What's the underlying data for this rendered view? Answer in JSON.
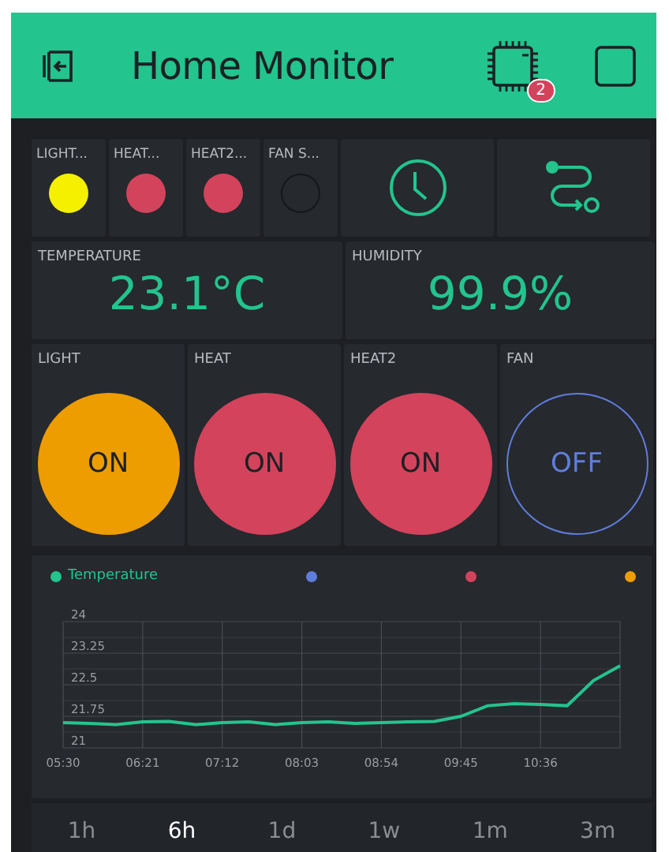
{
  "header": {
    "title": "Home Monitor",
    "badge": "2"
  },
  "leds": [
    {
      "label": "LIGHT...",
      "on": true,
      "color": "#f5f000"
    },
    {
      "label": "HEAT...",
      "on": true,
      "color": "#d3435c"
    },
    {
      "label": "HEAT2...",
      "on": true,
      "color": "#d3435c"
    },
    {
      "label": "FAN S...",
      "on": false
    }
  ],
  "displays": [
    {
      "label": "TEMPERATURE",
      "value": "23.1°C"
    },
    {
      "label": "HUMIDITY",
      "value": "99.9%"
    }
  ],
  "buttons": [
    {
      "label": "LIGHT",
      "state": "ON",
      "on": true,
      "color": "#ed9d00"
    },
    {
      "label": "HEAT",
      "state": "ON",
      "on": true,
      "color": "#d3435c"
    },
    {
      "label": "HEAT2",
      "state": "ON",
      "on": true,
      "color": "#d3435c"
    },
    {
      "label": "FAN",
      "state": "OFF",
      "on": false,
      "color": "#5f7ddb"
    }
  ],
  "legend": [
    {
      "color": "#5f7ddb"
    },
    {
      "color": "#d3435c"
    },
    {
      "color": "#ed9d00"
    }
  ],
  "chart_data": {
    "type": "line",
    "categories": [
      "05:30",
      null,
      null,
      "06:21",
      null,
      null,
      "07:12",
      null,
      null,
      "08:03",
      null,
      null,
      "08:54",
      null,
      null,
      "09:45",
      null,
      null,
      "10:36",
      null,
      null,
      null
    ],
    "series": [
      {
        "name": "Temperature",
        "color": "#23c48e",
        "values": [
          21.6,
          21.58,
          21.55,
          21.62,
          21.63,
          21.55,
          21.6,
          21.62,
          21.55,
          21.6,
          21.62,
          21.58,
          21.6,
          21.62,
          21.63,
          21.75,
          22.0,
          22.05,
          22.03,
          22.0,
          22.6,
          22.95
        ]
      }
    ],
    "ylim": [
      21,
      24
    ],
    "grid": true,
    "yticks": [
      21,
      21.75,
      22.5,
      23.25,
      24
    ]
  },
  "ranges": [
    {
      "label": "1h",
      "selected": false
    },
    {
      "label": "6h",
      "selected": true
    },
    {
      "label": "1d",
      "selected": false
    },
    {
      "label": "1w",
      "selected": false
    },
    {
      "label": "1m",
      "selected": false
    },
    {
      "label": "3m",
      "selected": false
    }
  ]
}
